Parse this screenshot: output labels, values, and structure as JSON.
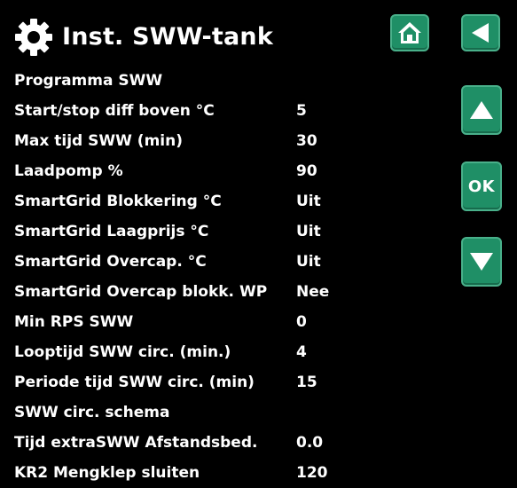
{
  "header": {
    "title": "Inst. SWW-tank",
    "icons": {
      "settings": "gear-icon",
      "home": "home-icon",
      "back": "back-arrow-icon"
    }
  },
  "nav": {
    "up_icon": "arrow-up-icon",
    "ok_label": "OK",
    "down_icon": "arrow-down-icon"
  },
  "colors": {
    "background": "#000000",
    "text": "#ffffff",
    "button": "#1f8f66",
    "button_border": "#49b08a"
  },
  "settings": [
    {
      "label": "Programma SWW",
      "value": ""
    },
    {
      "label": "Start/stop diff boven °C",
      "value": "5"
    },
    {
      "label": "Max tijd SWW (min)",
      "value": "30"
    },
    {
      "label": "Laadpomp %",
      "value": "90"
    },
    {
      "label": "SmartGrid Blokkering °C",
      "value": "Uit"
    },
    {
      "label": "SmartGrid Laagprijs °C",
      "value": "Uit"
    },
    {
      "label": "SmartGrid Overcap. °C",
      "value": "Uit"
    },
    {
      "label": "SmartGrid Overcap blokk. WP",
      "value": "Nee"
    },
    {
      "label": "Min RPS SWW",
      "value": "0"
    },
    {
      "label": "Looptijd SWW circ. (min.)",
      "value": "4"
    },
    {
      "label": "Periode tijd SWW circ. (min)",
      "value": "15"
    },
    {
      "label": "SWW circ. schema",
      "value": ""
    },
    {
      "label": "Tijd extraSWW Afstandsbed.",
      "value": "0.0"
    },
    {
      "label": "KR2 Mengklep sluiten",
      "value": "120"
    }
  ]
}
